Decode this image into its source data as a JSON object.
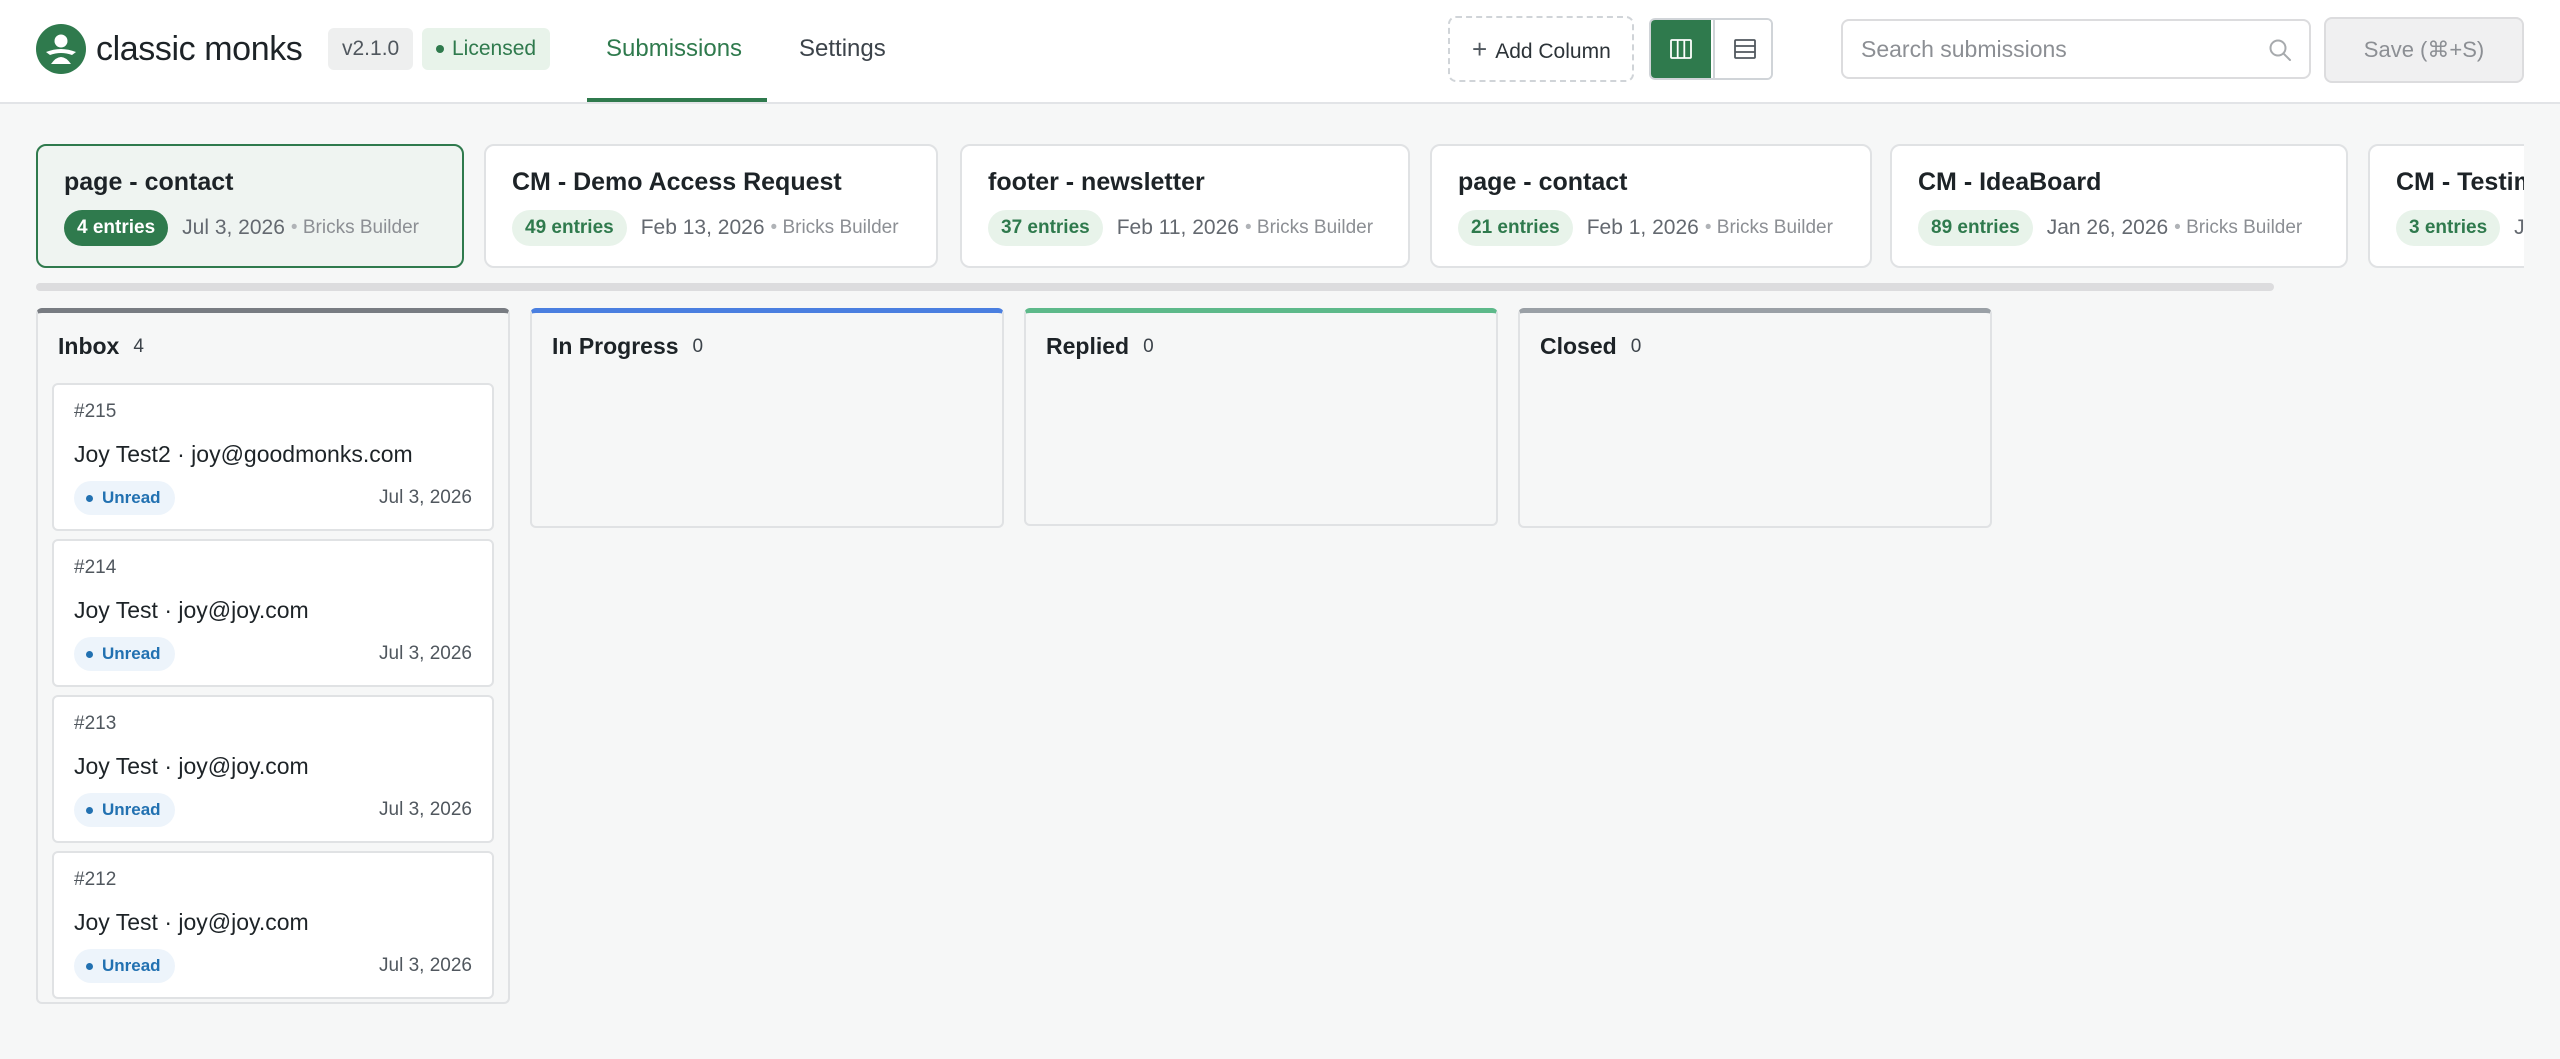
{
  "app": {
    "brand": "classic monks",
    "version": "v2.1.0",
    "license": "Licensed"
  },
  "nav": {
    "tabs": [
      {
        "label": "Submissions",
        "active": true
      },
      {
        "label": "Settings",
        "active": false
      }
    ]
  },
  "toolbar": {
    "add_column": "Add Column",
    "view_modes": [
      "board-view",
      "list-view"
    ],
    "active_view": "board-view",
    "search_placeholder": "Search submissions",
    "save_label": "Save (⌘+S)"
  },
  "forms": [
    {
      "title": "page - contact",
      "entries": "4 entries",
      "date": "Jul 3, 2026",
      "builder": "Bricks Builder",
      "active": true
    },
    {
      "title": "CM - Demo Access Request",
      "entries": "49 entries",
      "date": "Feb 13, 2026",
      "builder": "Bricks Builder",
      "active": false
    },
    {
      "title": "footer - newsletter",
      "entries": "37 entries",
      "date": "Feb 11, 2026",
      "builder": "Bricks Builder",
      "active": false
    },
    {
      "title": "page - contact",
      "entries": "21 entries",
      "date": "Feb 1, 2026",
      "builder": "Bricks Builder",
      "active": false
    },
    {
      "title": "CM - IdeaBoard",
      "entries": "89 entries",
      "date": "Jan 26, 2026",
      "builder": "Bricks Builder",
      "active": false
    },
    {
      "title": "CM - Testim",
      "entries": "3 entries",
      "date": "J",
      "builder": "",
      "active": false
    }
  ],
  "columns": [
    {
      "name": "Inbox",
      "count": "4",
      "color": "#787c82",
      "cards": [
        {
          "id": "#215",
          "who": "Joy Test2 · joy@goodmonks.com",
          "status": "Unread",
          "date": "Jul 3, 2026"
        },
        {
          "id": "#214",
          "who": "Joy Test · joy@joy.com",
          "status": "Unread",
          "date": "Jul 3, 2026"
        },
        {
          "id": "#213",
          "who": "Joy Test · joy@joy.com",
          "status": "Unread",
          "date": "Jul 3, 2026"
        },
        {
          "id": "#212",
          "who": "Joy Test · joy@joy.com",
          "status": "Unread",
          "date": "Jul 3, 2026"
        }
      ]
    },
    {
      "name": "In Progress",
      "count": "0",
      "color": "#4a7fe0",
      "cards": []
    },
    {
      "name": "Replied",
      "count": "0",
      "color": "#5db98a",
      "cards": []
    },
    {
      "name": "Closed",
      "count": "0",
      "color": "#9aa0a6",
      "cards": []
    }
  ],
  "colors": {
    "accent": "#2f7a4d",
    "unread": "#2271b1"
  }
}
